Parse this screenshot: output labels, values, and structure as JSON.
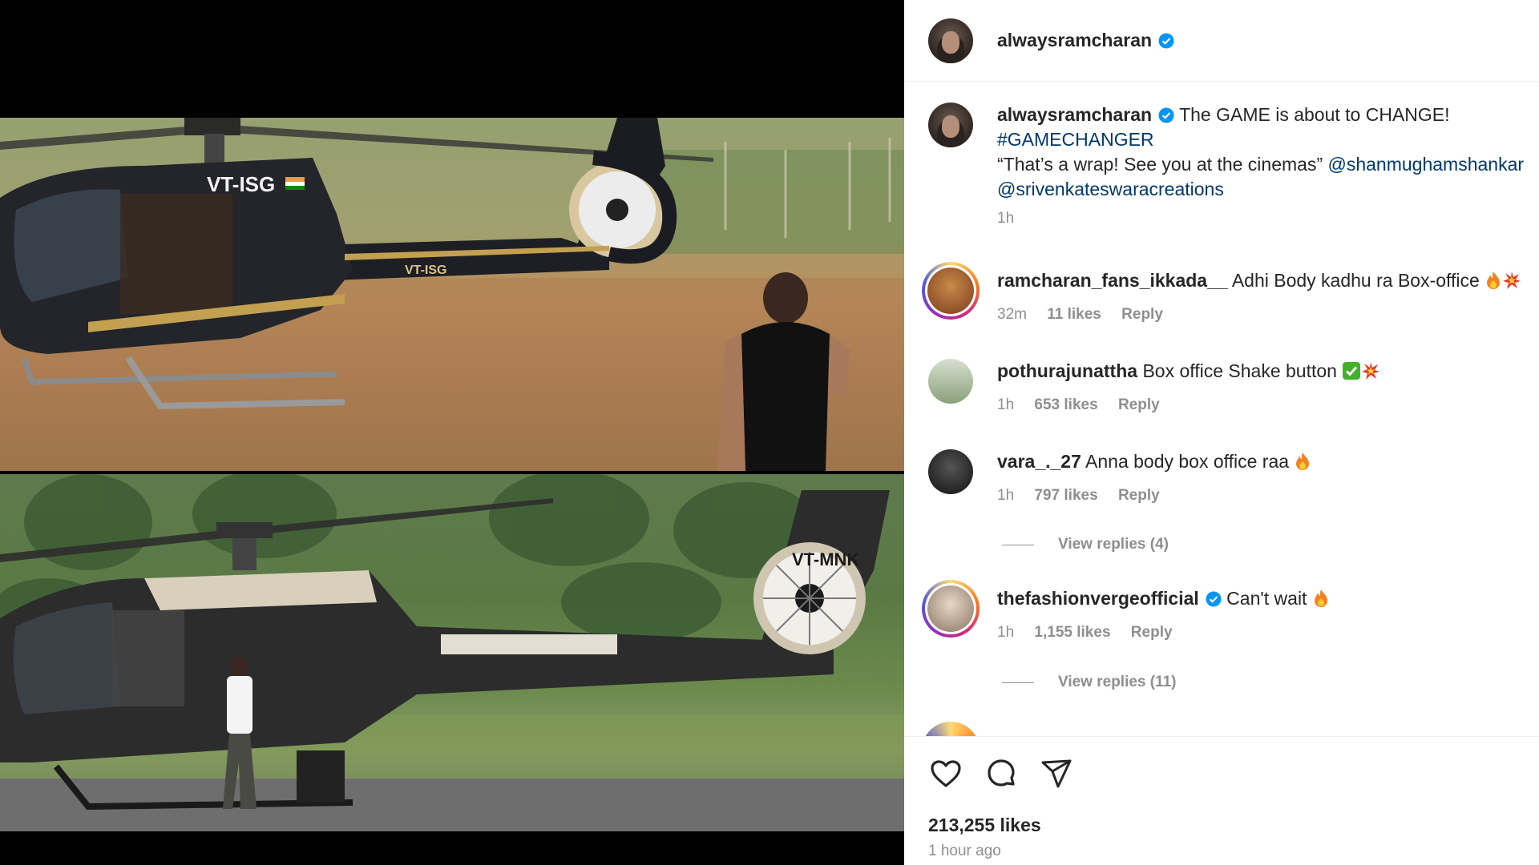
{
  "post": {
    "author": "alwaysramcharan",
    "caption_text": "The GAME is about to CHANGE!",
    "hashtag": "#GAMECHANGER",
    "quote": "“That’s a wrap! See you at the cinemas”",
    "mention_1": "@shanmughamshankar",
    "mention_2": "@srivenkateswaracreations",
    "time": "1h"
  },
  "media": {
    "top_tail_number": "VT-ISG",
    "top_boom_number": "VT-ISG",
    "bottom_tail_number": "VT-MNK"
  },
  "comments": [
    {
      "user": "ramcharan_fans_ikkada__",
      "text": "Adhi Body kadhu ra Box-office",
      "emoji": "fire-explosion",
      "time": "32m",
      "likes": "11 likes",
      "reply": "Reply",
      "verified": false
    },
    {
      "user": "pothurajunattha",
      "text": "Box office Shake button",
      "emoji": "check-explosion",
      "time": "1h",
      "likes": "653 likes",
      "reply": "Reply",
      "verified": false
    },
    {
      "user": "vara_._27",
      "text": "Anna body box office raa",
      "emoji": "fire",
      "time": "1h",
      "likes": "797 likes",
      "reply": "Reply",
      "verified": false
    },
    {
      "user": "thefashionvergeofficial",
      "text": "Can't wait",
      "emoji": "fire",
      "time": "1h",
      "likes": "1,155 likes",
      "reply": "Reply",
      "verified": true
    }
  ],
  "view_replies": [
    "View replies (4)",
    "View replies (11)"
  ],
  "footer": {
    "likes": "213,255 likes",
    "time_ago": "1 hour ago"
  },
  "colors": {
    "verified": "#0095f6",
    "link": "#00376b",
    "secondary_text": "#8e8e8e"
  }
}
